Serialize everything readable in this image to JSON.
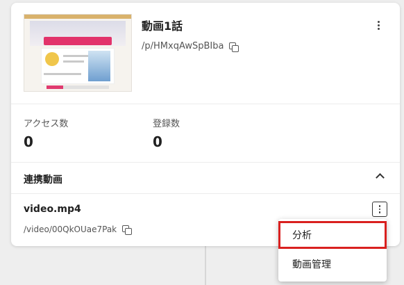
{
  "item": {
    "title": "動画1話",
    "path": "/p/HMxqAwSpBIba"
  },
  "stats": {
    "access_label": "アクセス数",
    "access_value": "0",
    "register_label": "登録数",
    "register_value": "0"
  },
  "linked": {
    "section_title": "連携動画",
    "video_name": "video.mp4",
    "video_path": "/video/00QkOUae7Pak"
  },
  "menu": {
    "items": [
      "分析",
      "動画管理"
    ]
  },
  "colors": {
    "highlight": "#d9201f",
    "accent": "#e2336b"
  }
}
